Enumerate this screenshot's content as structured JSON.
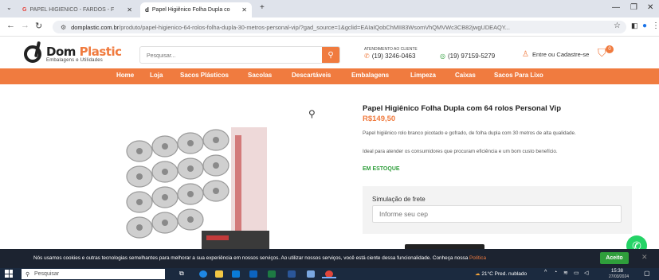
{
  "browser": {
    "tabs": [
      {
        "label": "PAPEL HIGIENICO - FARDOS - F",
        "active": false
      },
      {
        "label": "Papel Higiênico Folha Dupla co",
        "active": true
      }
    ],
    "new_tab": "+",
    "url_domain": "domplastic.com.br",
    "url_path": "/produto/papel-higienico-64-rolos-folha-dupla-30-metros-personal-vip/?gad_source=1&gclid=EAIaIQobChMII83WsomVhQMVWc3CB82jwgUDEAQY..."
  },
  "header": {
    "logo_name_part1": "Dom",
    "logo_name_part2": "Plastic",
    "logo_sub": "Embalagens e Utilidades",
    "search_placeholder": "Pesquisar...",
    "atendimento_label": "ATENDIMENTO AO CLIENTE",
    "phone1": "(19) 3246-0463",
    "phone2": "(19) 97159-5279",
    "account_label": "Entre ou Cadastre-se",
    "cart_count": "0"
  },
  "nav": {
    "items": [
      "Home",
      "Loja",
      "Sacos Plásticos",
      "Sacolas",
      "Descartáveis",
      "Embalagens",
      "Limpeza",
      "Caixas",
      "Sacos Para Lixo"
    ]
  },
  "product": {
    "title": "Papel Higiênico Folha Dupla com 64 rolos Personal Vip",
    "price": "R$149,50",
    "description1": "Papel higiênico rolo branco picotado e gofrado, de folha dupla com 30 metros de alta qualidade.",
    "description2": "Ideal para atender os consumidores que procuram eficiência e um bom custo benefício.",
    "stock": "EM ESTOQUE",
    "shipping_title": "Simulação de frete",
    "shipping_placeholder": "Informe seu cep"
  },
  "cookie": {
    "text": "Nós usamos cookies e outras tecnologias semelhantes para melhorar a sua experiência em nossos serviços. Ao utilizar nossos serviços, você está ciente dessa funcionalidade. Conheça nossa ",
    "link": "Política",
    "accept": "Aceito"
  },
  "taskbar": {
    "search_placeholder": "Pesquisar",
    "weather": "21°C Pred. nublado",
    "time": "15:38",
    "date": "27/03/2024"
  },
  "colors": {
    "brand_orange": "#f07b3f",
    "stock_green": "#2f9e3b",
    "cookie_bg": "#1c2330",
    "taskbar_bg": "#1b2a3f"
  }
}
